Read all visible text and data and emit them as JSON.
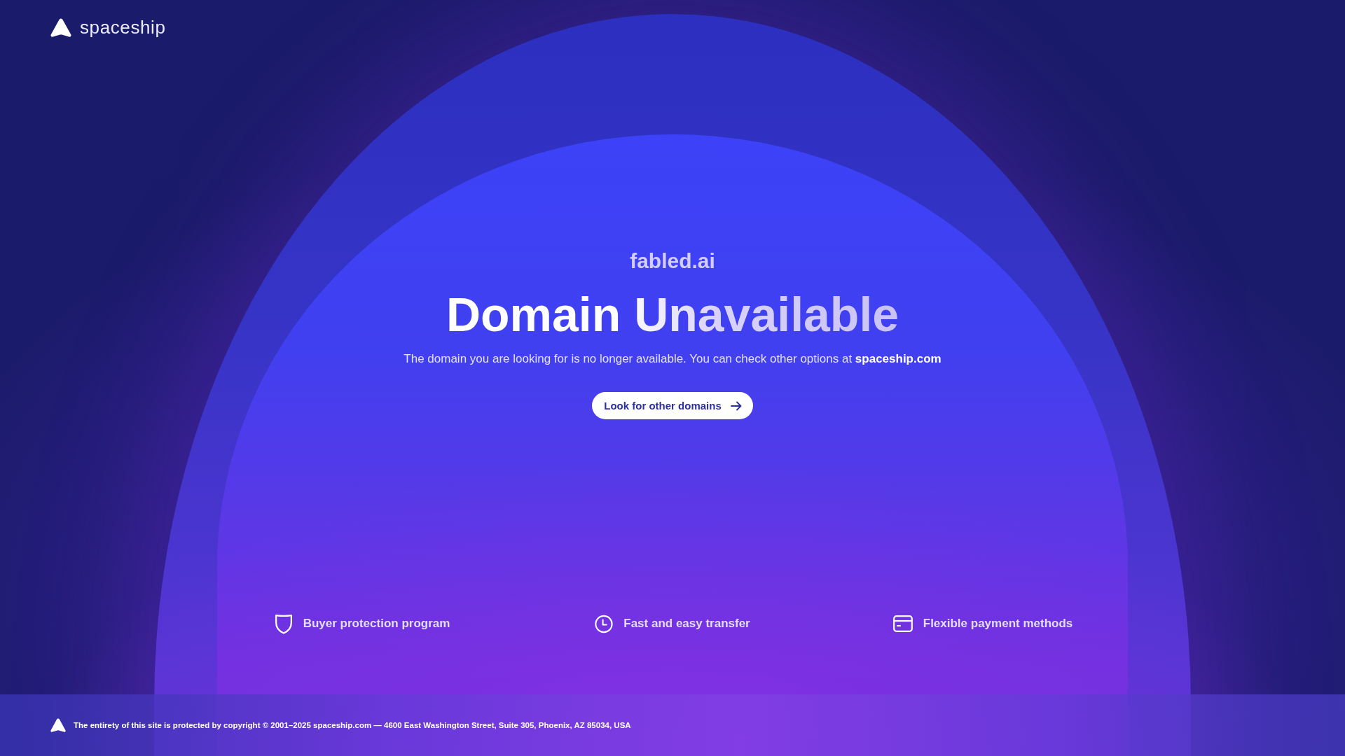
{
  "header": {
    "logo_text": "spaceship"
  },
  "domain": "fabled.ai",
  "title": "Domain Unavailable",
  "message": {
    "text": "The domain you are looking for is no longer available. You can check other options at",
    "link": "spaceship.com"
  },
  "button": {
    "label": "Look for other domains"
  },
  "features": [
    {
      "kind": "shield",
      "label": "Buyer protection program"
    },
    {
      "kind": "clock",
      "label": "Fast and easy transfer"
    },
    {
      "kind": "card",
      "label": "Flexible payment methods"
    }
  ],
  "footer": {
    "text": "The entirety of this site is protected by copyright © 2001–2025 spaceship.com — 4600 East Washington Street, Suite 305, Phoenix, AZ 85034, USA"
  }
}
